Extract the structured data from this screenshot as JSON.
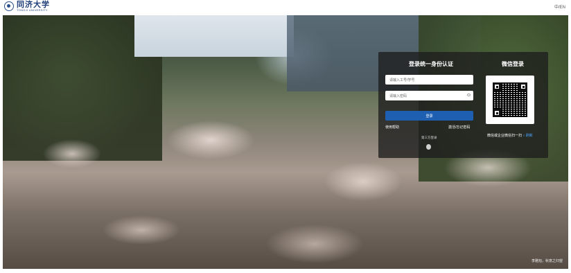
{
  "header": {
    "logo_cn": "同济大学",
    "logo_en": "TONGJI UNIVERSITY",
    "lang_switch": "中/EN"
  },
  "login": {
    "title": "登录统一身份认证",
    "username_placeholder": "请输入工号/学号",
    "password_placeholder": "请输入密码",
    "submit_label": "登录",
    "help_label": "使用帮助",
    "forgot_label": "激活/忘记密码",
    "third_party_label": "第三方登录"
  },
  "wechat": {
    "title": "微信登录",
    "tip": "微信或企业微信扫一扫",
    "refresh_label": "○ 刷新"
  },
  "photo": {
    "credit": "李雅旭，秋意之归望"
  },
  "icons": [
    "university-seal-icon",
    "password-eye-icon",
    "third-party-login-icon",
    "wechat-qr-code"
  ]
}
